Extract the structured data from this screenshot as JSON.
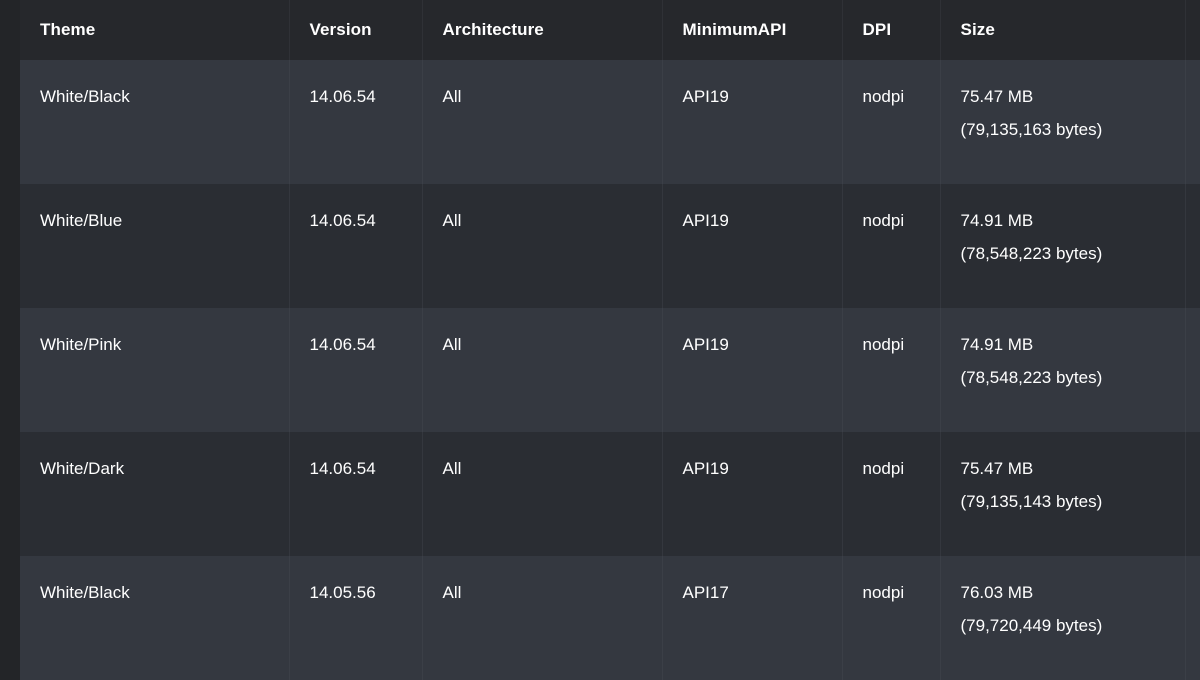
{
  "table": {
    "columns": [
      {
        "key": "theme",
        "label": "Theme"
      },
      {
        "key": "version",
        "label": "Version"
      },
      {
        "key": "architecture",
        "label": "Architecture"
      },
      {
        "key": "minimum_api",
        "label": "MinimumAPI"
      },
      {
        "key": "dpi",
        "label": "DPI"
      },
      {
        "key": "size",
        "label": "Size"
      }
    ],
    "rows": [
      {
        "theme": "White/Black",
        "version": "14.06.54",
        "architecture": "All",
        "minimum_api": "API19",
        "dpi": "nodpi",
        "size_mb": "75.47 MB",
        "size_bytes": "(79,135,163 bytes)"
      },
      {
        "theme": "White/Blue",
        "version": "14.06.54",
        "architecture": "All",
        "minimum_api": "API19",
        "dpi": "nodpi",
        "size_mb": "74.91 MB",
        "size_bytes": "(78,548,223 bytes)"
      },
      {
        "theme": "White/Pink",
        "version": "14.06.54",
        "architecture": "All",
        "minimum_api": "API19",
        "dpi": "nodpi",
        "size_mb": "74.91 MB",
        "size_bytes": "(78,548,223 bytes)"
      },
      {
        "theme": "White/Dark",
        "version": "14.06.54",
        "architecture": "All",
        "minimum_api": "API19",
        "dpi": "nodpi",
        "size_mb": "75.47 MB",
        "size_bytes": "(79,135,143 bytes)"
      },
      {
        "theme": "White/Black",
        "version": "14.05.56",
        "architecture": "All",
        "minimum_api": "API17",
        "dpi": "nodpi",
        "size_mb": "76.03 MB",
        "size_bytes": "(79,720,449 bytes)"
      }
    ]
  },
  "colors": {
    "page_background": "#232528",
    "header_background": "#26282c",
    "row_odd_background": "#343840",
    "row_even_background": "#2a2d33",
    "text": "#ffffff",
    "divider": "#3b3f47"
  }
}
